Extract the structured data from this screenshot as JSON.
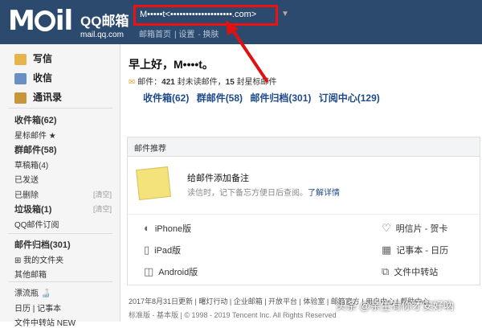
{
  "header": {
    "logo_text": "M ил",
    "logo_cn": "QQ邮箱",
    "logo_domain": "mail.qq.com",
    "user_display": "M•••••t<••••••••••••••••••••.com>",
    "links": [
      "邮箱首页",
      "设置",
      "换肤"
    ]
  },
  "sidebar": {
    "compose": "写信",
    "inbox": "收信",
    "contacts": "通讯录",
    "folders": [
      {
        "label": "收件箱(62)",
        "bold": true
      },
      {
        "label": "星标邮件 ★",
        "bold": false
      },
      {
        "label": "群邮件(58)",
        "bold": true
      },
      {
        "label": "草稿箱(4)",
        "bold": false
      },
      {
        "label": "已发送",
        "bold": false
      },
      {
        "label": "已删除",
        "bold": false,
        "action": "[清空]"
      },
      {
        "label": "垃圾箱(1)",
        "bold": true,
        "action": "[清空]"
      },
      {
        "label": "QQ邮件订阅",
        "bold": false
      }
    ],
    "archive": "邮件归档(301)",
    "my_folders": "⊞ 我的文件夹",
    "other": "其他邮箱",
    "extras": [
      "漂流瓶 🍶",
      "日历 | 记事本",
      "文件中转站 NEW"
    ]
  },
  "main": {
    "greeting": "早上好，M••••t。",
    "summary_prefix": "邮件：",
    "summary_count": "421",
    "summary_unread_label": " 封未读邮件，",
    "summary_star_count": "15",
    "summary_star_label": " 封星标邮件",
    "quick_links": [
      "收件箱(62)",
      "群邮件(58)",
      "邮件归档(301)",
      "订阅中心(129)"
    ]
  },
  "card": {
    "title": "邮件推荐",
    "note_title": "给邮件添加备注",
    "note_desc": "读信时，记下备忘方便日后查阅。",
    "note_link": "了解详情",
    "apps_left": [
      {
        "icon": "apple-icon",
        "label": "iPhone版"
      },
      {
        "icon": "ipad-icon",
        "label": "iPad版"
      },
      {
        "icon": "android-icon",
        "label": "Android版"
      }
    ],
    "apps_right": [
      {
        "icon": "heart-icon",
        "label": "明信片 - 贺卡"
      },
      {
        "icon": "calendar-icon",
        "label": "记事本 - 日历"
      },
      {
        "icon": "transfer-icon",
        "label": "文件中转站"
      }
    ]
  },
  "footer": {
    "line1": "2017年8月31日更新 | 曙灯行动 | 企业邮箱 | 开放平台 | 体验室 | 邮箱官方 | 用户中心 | 帮助中心",
    "line2": "标准版 - 基本版 | © 1998 - 2019 Tencent Inc. All Rights Reserved"
  },
  "watermark": "头条 @亲生有你才安好吶",
  "colors": {
    "header": "#2c4a6e",
    "annotation": "#e11111",
    "link": "#1e4a8a"
  }
}
